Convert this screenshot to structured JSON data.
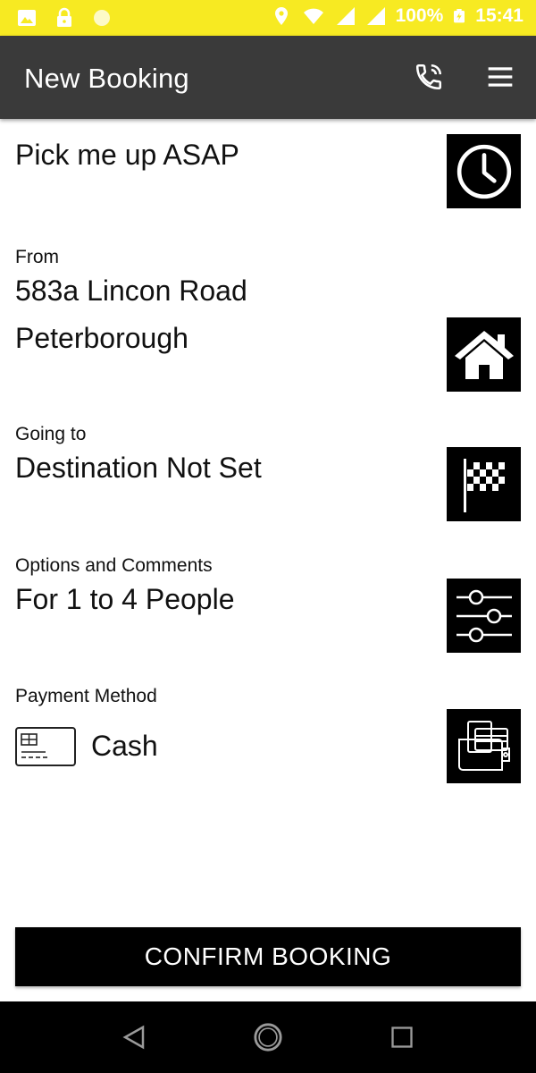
{
  "status_bar": {
    "battery": "100%",
    "time": "15:41",
    "icons": [
      "image-icon",
      "lock-icon",
      "circle-icon",
      "location-icon",
      "wifi-icon",
      "signal-icon",
      "signal-icon",
      "battery-charging-icon"
    ]
  },
  "app_bar": {
    "title": "New Booking",
    "actions": [
      "phone-call-icon",
      "menu-icon"
    ]
  },
  "pickup_time": {
    "value": "Pick me up ASAP",
    "icon": "clock-icon"
  },
  "from": {
    "label": "From",
    "line1": "583a Lincon Road",
    "line2": "Peterborough",
    "icon": "home-icon"
  },
  "going_to": {
    "label": "Going to",
    "value": "Destination Not Set",
    "icon": "checkered-flag-icon"
  },
  "options": {
    "label": "Options and Comments",
    "value": "For 1 to 4 People",
    "icon": "sliders-icon"
  },
  "payment": {
    "label": "Payment Method",
    "value": "Cash",
    "card_icon": "payment-card-icon",
    "icon": "wallet-icon"
  },
  "confirm_button": {
    "label": "CONFIRM BOOKING"
  },
  "nav_bar": {
    "buttons": [
      "back-icon",
      "home-circle-icon",
      "recents-icon"
    ]
  },
  "colors": {
    "status_bar": "#f7ea22",
    "app_bar": "#3a3a3a",
    "tile": "#000000",
    "button": "#000000"
  }
}
